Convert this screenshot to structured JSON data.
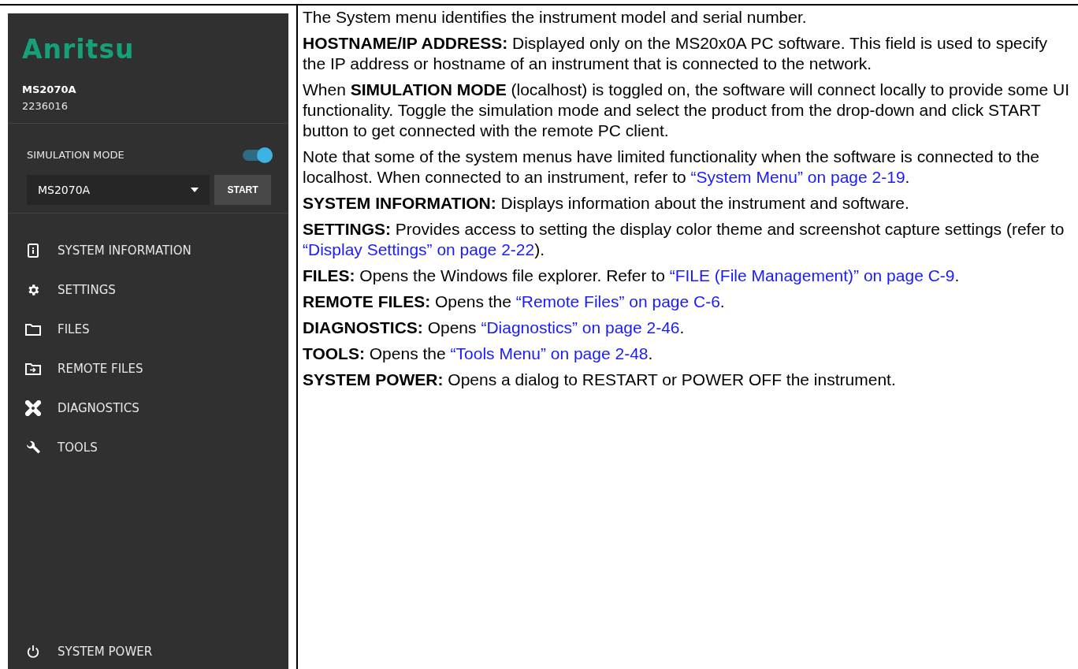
{
  "sidebar": {
    "logo": "Anritsu",
    "model": "MS2070A",
    "serial": "2236016",
    "simulation_mode": {
      "label": "SIMULATION MODE",
      "on": true
    },
    "product_select": {
      "value": "MS2070A"
    },
    "start_button": "START",
    "menu": [
      {
        "kind": "info",
        "label": "SYSTEM INFORMATION"
      },
      {
        "kind": "gear",
        "label": "SETTINGS"
      },
      {
        "kind": "folder",
        "label": "FILES"
      },
      {
        "kind": "remote-folder",
        "label": "REMOTE FILES"
      },
      {
        "kind": "diagnostics",
        "label": "DIAGNOSTICS"
      },
      {
        "kind": "tools",
        "label": "TOOLS"
      }
    ],
    "power_item": {
      "kind": "power",
      "label": "SYSTEM POWER"
    }
  },
  "description": [
    [
      {
        "kind": "text",
        "text": "The System menu identifies the instrument model and serial number."
      }
    ],
    [
      {
        "kind": "text",
        "text": "**HOSTNAME/IP ADDRESS:**  Displayed only on the MS20x0A PC software. This field is used to specify the IP address or hostname of an instrument that is connected to the network."
      }
    ],
    [
      {
        "kind": "text",
        "text": "When **SIMULATION MODE** (localhost) is toggled on, the software will connect locally to provide some UI functionality. Toggle the simulation mode and select the product from the drop-down and click START button to get connected with the remote PC client."
      }
    ],
    [
      {
        "kind": "text",
        "text": "Note that some of the system menus have limited functionality when the software is connected to the localhost. When connected to an instrument, refer to "
      },
      {
        "kind": "link",
        "text": "“System Menu” on page 2-19"
      },
      {
        "kind": "text",
        "text": "."
      }
    ],
    [
      {
        "kind": "text",
        "text": "**SYSTEM INFORMATION:**  Displays information about the instrument and software."
      }
    ],
    [
      {
        "kind": "text",
        "text": "**SETTINGS:**  Provides access to setting the display color theme and screenshot capture settings (refer to "
      },
      {
        "kind": "link",
        "text": "“Display Settings” on page 2-22"
      },
      {
        "kind": "text",
        "text": ")."
      }
    ],
    [
      {
        "kind": "text",
        "text": "**FILES:**  Opens the Windows file explorer. Refer to "
      },
      {
        "kind": "link",
        "text": "“FILE (File Management)” on page C-9"
      },
      {
        "kind": "text",
        "text": "."
      }
    ],
    [
      {
        "kind": "text",
        "text": "**REMOTE FILES:**  Opens the "
      },
      {
        "kind": "link",
        "text": "“Remote Files” on page C-6"
      },
      {
        "kind": "text",
        "text": "."
      }
    ],
    [
      {
        "kind": "text",
        "text": "**DIAGNOSTICS:**  Opens "
      },
      {
        "kind": "link",
        "text": "“Diagnostics” on page 2-46"
      },
      {
        "kind": "text",
        "text": "."
      }
    ],
    [
      {
        "kind": "text",
        "text": "**TOOLS:**  Opens the "
      },
      {
        "kind": "link",
        "text": "“Tools Menu” on page 2-48"
      },
      {
        "kind": "text",
        "text": "."
      }
    ],
    [
      {
        "kind": "text",
        "text": "**SYSTEM POWER:**  Opens a dialog to RESTART or POWER OFF the instrument."
      }
    ]
  ]
}
